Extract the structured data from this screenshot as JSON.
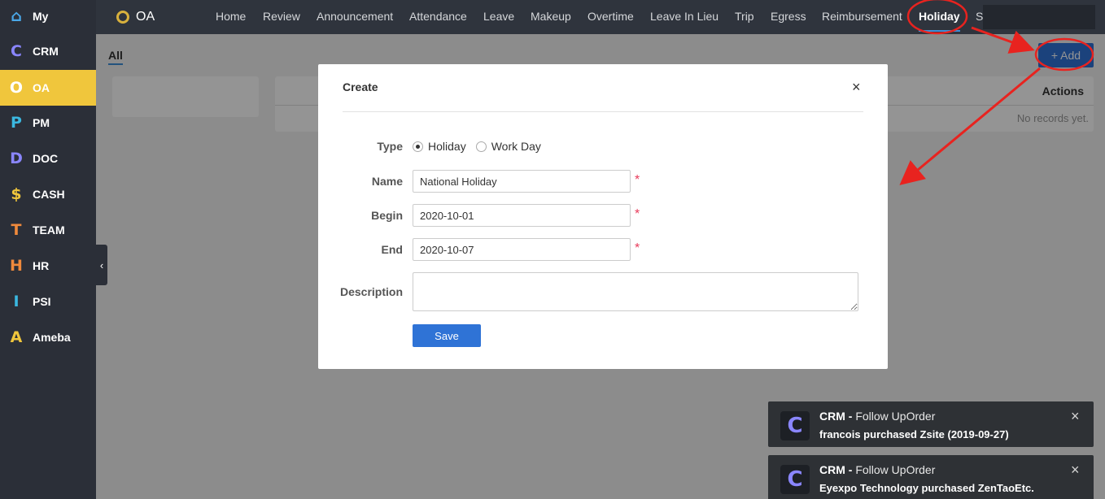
{
  "sidebar": {
    "items": [
      {
        "label": "My",
        "glyph": "⌂",
        "color": "#4aa8e8",
        "active": false
      },
      {
        "label": "CRM",
        "glyph": "C",
        "color": "#8a86ff",
        "active": false
      },
      {
        "label": "OA",
        "glyph": "O",
        "color": "#ffffff",
        "active": true
      },
      {
        "label": "PM",
        "glyph": "P",
        "color": "#3bb8e0",
        "active": false
      },
      {
        "label": "DOC",
        "glyph": "D",
        "color": "#8a86ff",
        "active": false
      },
      {
        "label": "CASH",
        "glyph": "$",
        "color": "#f0c63c",
        "active": false
      },
      {
        "label": "TEAM",
        "glyph": "T",
        "color": "#f08a3c",
        "active": false
      },
      {
        "label": "HR",
        "glyph": "H",
        "color": "#f08a3c",
        "active": false
      },
      {
        "label": "PSI",
        "glyph": "I",
        "color": "#3bb8e0",
        "active": false
      },
      {
        "label": "Ameba",
        "glyph": "A",
        "color": "#f0c63c",
        "active": false
      }
    ],
    "collapse_glyph": "‹"
  },
  "topnav": {
    "brand": "OA",
    "items": [
      {
        "label": "Home",
        "active": false
      },
      {
        "label": "Review",
        "active": false
      },
      {
        "label": "Announcement",
        "active": false
      },
      {
        "label": "Attendance",
        "active": false
      },
      {
        "label": "Leave",
        "active": false
      },
      {
        "label": "Makeup",
        "active": false
      },
      {
        "label": "Overtime",
        "active": false
      },
      {
        "label": "Leave In Lieu",
        "active": false
      },
      {
        "label": "Trip",
        "active": false
      },
      {
        "label": "Egress",
        "active": false
      },
      {
        "label": "Reimbursement",
        "active": false
      },
      {
        "label": "Holiday",
        "active": true
      },
      {
        "label": "S",
        "active": false
      }
    ]
  },
  "main": {
    "tab_all": "All",
    "add_label": "+ Add",
    "table_actions_header": "Actions",
    "empty_text": "No records yet."
  },
  "modal": {
    "title": "Create",
    "close_glyph": "×",
    "type_label": "Type",
    "type_options": [
      "Holiday",
      "Work Day"
    ],
    "type_selected": "Holiday",
    "name_label": "Name",
    "name_value": "National Holiday",
    "begin_label": "Begin",
    "begin_value": "2020-10-01",
    "end_label": "End",
    "end_value": "2020-10-07",
    "description_label": "Description",
    "required_mark": "*",
    "save_label": "Save"
  },
  "notifications": [
    {
      "app": "CRM -",
      "title": "Follow UpOrder",
      "text": "francois purchased Zsite (2019-09-27)",
      "glyph": "C",
      "close": "×"
    },
    {
      "app": "CRM -",
      "title": "Follow UpOrder",
      "text": "Eyexpo Technology purchased ZenTaoEtc.",
      "glyph": "C",
      "close": "×"
    }
  ],
  "colors": {
    "accent": "#2f73d6",
    "sidebar_active": "#f0c63c",
    "annotation": "#e8231f",
    "required": "#e83b5b"
  }
}
